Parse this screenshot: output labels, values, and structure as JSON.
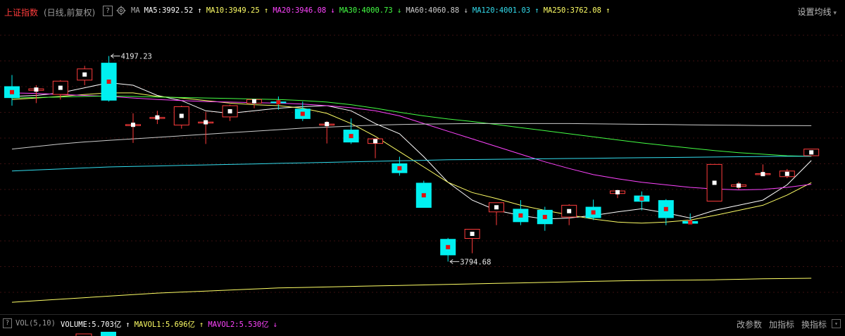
{
  "header": {
    "title": "上证指数",
    "subtitle": "(日线,前复权)",
    "help": "?",
    "ma_prefix": "MA",
    "ma_items": [
      {
        "label": "MA5:3992.52",
        "arrow": "↑",
        "color": "#ffffff"
      },
      {
        "label": "MA10:3949.25",
        "arrow": "↑",
        "color": "#ffff66"
      },
      {
        "label": "MA20:3946.08",
        "arrow": "↓",
        "color": "#ff44ff"
      },
      {
        "label": "MA30:4000.73",
        "arrow": "↓",
        "color": "#44ff44"
      },
      {
        "label": "MA60:4060.88",
        "arrow": "↓",
        "color": "#cccccc"
      },
      {
        "label": "MA120:4001.03",
        "arrow": "↑",
        "color": "#33ddee"
      },
      {
        "label": "MA250:3762.08",
        "arrow": "↑",
        "color": "#ffff66"
      }
    ],
    "settings_label": "设置均线",
    "settings_arrow": "▾",
    "close": "×"
  },
  "chart_data": {
    "type": "candlestick",
    "ylim": [
      3700,
      4260
    ],
    "annotations": {
      "high": "4197.23",
      "low": "3794.68"
    },
    "candles": [
      {
        "o": 4138,
        "h": 4160,
        "l": 4100,
        "c": 4115
      },
      {
        "o": 4130,
        "h": 4140,
        "l": 4105,
        "c": 4133
      },
      {
        "o": 4122,
        "h": 4150,
        "l": 4112,
        "c": 4148
      },
      {
        "o": 4150,
        "h": 4178,
        "l": 4140,
        "c": 4172
      },
      {
        "o": 4184,
        "h": 4197.23,
        "l": 4108,
        "c": 4110
      },
      {
        "o": 4062,
        "h": 4085,
        "l": 4027,
        "c": 4063
      },
      {
        "o": 4077,
        "h": 4090,
        "l": 4064,
        "c": 4077
      },
      {
        "o": 4062,
        "h": 4100,
        "l": 4055,
        "c": 4098
      },
      {
        "o": 4067,
        "h": 4088,
        "l": 4025,
        "c": 4068
      },
      {
        "o": 4078,
        "h": 4102,
        "l": 4070,
        "c": 4100
      },
      {
        "o": 4105,
        "h": 4110,
        "l": 4095,
        "c": 4112
      },
      {
        "o": 4108,
        "h": 4118,
        "l": 4092,
        "c": 4105
      },
      {
        "o": 4094,
        "h": 4108,
        "l": 4070,
        "c": 4074
      },
      {
        "o": 4064,
        "h": 4070,
        "l": 4026,
        "c": 4064
      },
      {
        "o": 4053,
        "h": 4075,
        "l": 4025,
        "c": 4028
      },
      {
        "o": 4026,
        "h": 4036,
        "l": 3997,
        "c": 4035
      },
      {
        "o": 3987,
        "h": 4000,
        "l": 3963,
        "c": 3968
      },
      {
        "o": 3949,
        "h": 3953,
        "l": 3900,
        "c": 3900
      },
      {
        "o": 3839,
        "h": 3841,
        "l": 3794.68,
        "c": 3807
      },
      {
        "o": 3840,
        "h": 3855,
        "l": 3811,
        "c": 3858
      },
      {
        "o": 3892,
        "h": 3894,
        "l": 3866,
        "c": 3910
      },
      {
        "o": 3898,
        "h": 3915,
        "l": 3866,
        "c": 3872
      },
      {
        "o": 3896,
        "h": 3902,
        "l": 3855,
        "c": 3868
      },
      {
        "o": 3882,
        "h": 3907,
        "l": 3866,
        "c": 3905
      },
      {
        "o": 3902,
        "h": 3916,
        "l": 3876,
        "c": 3880
      },
      {
        "o": 3928,
        "h": 3934,
        "l": 3919,
        "c": 3933
      },
      {
        "o": 3924,
        "h": 3932,
        "l": 3895,
        "c": 3912
      },
      {
        "o": 3915,
        "h": 3917,
        "l": 3866,
        "c": 3880
      },
      {
        "o": 3874,
        "h": 3889,
        "l": 3869,
        "c": 3869
      },
      {
        "o": 3913,
        "h": 3985,
        "l": 3913,
        "c": 3985
      },
      {
        "o": 3942,
        "h": 3951,
        "l": 3936,
        "c": 3945
      },
      {
        "o": 3965,
        "h": 3985,
        "l": 3962,
        "c": 3967
      },
      {
        "o": 3961,
        "h": 3976,
        "l": 3958,
        "c": 3972
      },
      {
        "o": 4002,
        "h": 4015,
        "l": 4001,
        "c": 4015
      }
    ],
    "ma_lines": [
      {
        "name": "MA5",
        "color": "#ffffff",
        "values": [
          4118,
          4120,
          4125,
          4135,
          4145,
          4140,
          4120,
          4110,
          4090,
          4085,
          4090,
          4095,
          4098,
          4100,
          4090,
          4065,
          4045,
          4000,
          3950,
          3915,
          3895,
          3885,
          3878,
          3880,
          3885,
          3892,
          3898,
          3890,
          3880,
          3895,
          3905,
          3915,
          3945,
          3992.52
        ]
      },
      {
        "name": "MA10",
        "color": "#ffff66",
        "values": [
          4112,
          4115,
          4118,
          4122,
          4125,
          4125,
          4118,
          4115,
          4110,
          4105,
          4102,
          4100,
          4095,
          4085,
          4065,
          4040,
          4010,
          3980,
          3950,
          3930,
          3918,
          3905,
          3895,
          3886,
          3878,
          3872,
          3870,
          3872,
          3876,
          3885,
          3895,
          3905,
          3925,
          3949.25
        ]
      },
      {
        "name": "MA20",
        "color": "#ff44ff",
        "values": [
          4125,
          4124,
          4122,
          4120,
          4118,
          4115,
          4112,
          4110,
          4108,
          4107,
          4106,
          4105,
          4103,
          4100,
          4096,
          4090,
          4080,
          4065,
          4050,
          4035,
          4020,
          4005,
          3990,
          3977,
          3965,
          3957,
          3950,
          3945,
          3940,
          3937,
          3935,
          3936,
          3940,
          3946.08
        ]
      },
      {
        "name": "MA30",
        "color": "#44ff44",
        "values": [
          4115,
          4116,
          4117,
          4118,
          4119,
          4118,
          4117,
          4116,
          4115,
          4114,
          4113,
          4112,
          4110,
          4107,
          4102,
          4095,
          4087,
          4080,
          4074,
          4069,
          4063,
          4057,
          4051,
          4045,
          4039,
          4033,
          4027,
          4022,
          4017,
          4012,
          4008,
          4005,
          4002,
          4000.73
        ]
      },
      {
        "name": "MA60",
        "color": "#cccccc",
        "values": [
          4015,
          4020,
          4025,
          4029,
          4032,
          4035,
          4038,
          4041,
          4044,
          4047,
          4050,
          4053,
          4056,
          4058,
          4060,
          4062,
          4063,
          4064,
          4064.5,
          4065,
          4065,
          4065,
          4065,
          4065,
          4064.5,
          4064,
          4063.5,
          4063,
          4062.5,
          4062,
          4061.5,
          4061,
          4061,
          4060.88
        ]
      },
      {
        "name": "MA120",
        "color": "#33ddee",
        "values": [
          3972,
          3974,
          3976,
          3978,
          3980,
          3981,
          3982,
          3983,
          3984,
          3985,
          3986,
          3987,
          3988,
          3989,
          3990,
          3991,
          3992,
          3993,
          3994,
          3994.5,
          3995,
          3995.5,
          3996,
          3996.5,
          3997,
          3997.5,
          3998,
          3998.5,
          3999,
          3999.5,
          4000,
          4000.5,
          4000.8,
          4001.03
        ]
      },
      {
        "name": "MA250",
        "color": "#ffff66",
        "values": [
          3715,
          3718,
          3721,
          3724,
          3727,
          3730,
          3733,
          3735,
          3737,
          3739,
          3741,
          3743,
          3744,
          3745,
          3746,
          3747,
          3748,
          3749,
          3750,
          3751,
          3752,
          3753,
          3754,
          3755,
          3756,
          3757,
          3757.5,
          3758,
          3758.5,
          3759,
          3760,
          3761,
          3761.5,
          3762.08
        ]
      }
    ]
  },
  "volume_bar": {
    "help": "?",
    "label": "VOL(5,10)",
    "items": [
      {
        "text": "VOLUME:5.703亿",
        "color": "#ffffff"
      },
      {
        "text": "↑",
        "color": "#ffffff"
      },
      {
        "text": "MAVOL1:5.696亿",
        "color": "#ffff66"
      },
      {
        "text": "↑",
        "color": "#ffff66"
      },
      {
        "text": "MAVOL2:5.530亿",
        "color": "#ff44ff"
      },
      {
        "text": "↓",
        "color": "#ff44ff"
      }
    ],
    "tools": [
      "改参数",
      "加指标",
      "换指标"
    ],
    "dropdown": "▾"
  }
}
